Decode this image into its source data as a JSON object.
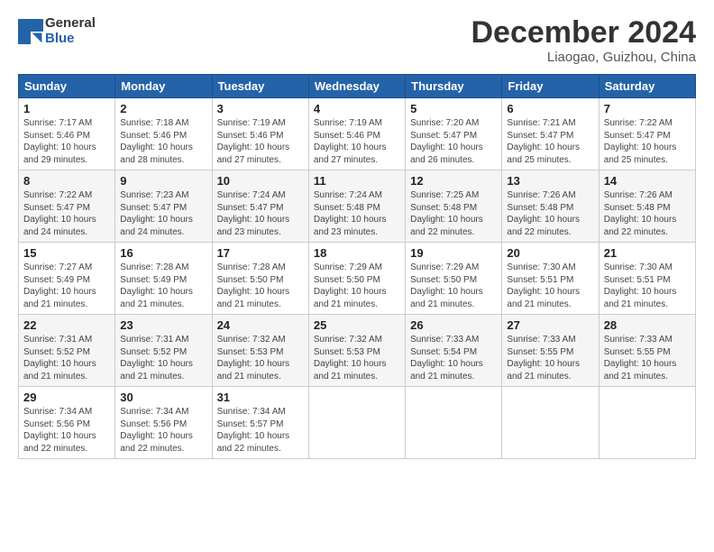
{
  "header": {
    "logo_line1": "General",
    "logo_line2": "Blue",
    "month": "December 2024",
    "location": "Liaogao, Guizhou, China"
  },
  "weekdays": [
    "Sunday",
    "Monday",
    "Tuesday",
    "Wednesday",
    "Thursday",
    "Friday",
    "Saturday"
  ],
  "weeks": [
    [
      {
        "day": "1",
        "info": "Sunrise: 7:17 AM\nSunset: 5:46 PM\nDaylight: 10 hours\nand 29 minutes."
      },
      {
        "day": "2",
        "info": "Sunrise: 7:18 AM\nSunset: 5:46 PM\nDaylight: 10 hours\nand 28 minutes."
      },
      {
        "day": "3",
        "info": "Sunrise: 7:19 AM\nSunset: 5:46 PM\nDaylight: 10 hours\nand 27 minutes."
      },
      {
        "day": "4",
        "info": "Sunrise: 7:19 AM\nSunset: 5:46 PM\nDaylight: 10 hours\nand 27 minutes."
      },
      {
        "day": "5",
        "info": "Sunrise: 7:20 AM\nSunset: 5:47 PM\nDaylight: 10 hours\nand 26 minutes."
      },
      {
        "day": "6",
        "info": "Sunrise: 7:21 AM\nSunset: 5:47 PM\nDaylight: 10 hours\nand 25 minutes."
      },
      {
        "day": "7",
        "info": "Sunrise: 7:22 AM\nSunset: 5:47 PM\nDaylight: 10 hours\nand 25 minutes."
      }
    ],
    [
      {
        "day": "8",
        "info": "Sunrise: 7:22 AM\nSunset: 5:47 PM\nDaylight: 10 hours\nand 24 minutes."
      },
      {
        "day": "9",
        "info": "Sunrise: 7:23 AM\nSunset: 5:47 PM\nDaylight: 10 hours\nand 24 minutes."
      },
      {
        "day": "10",
        "info": "Sunrise: 7:24 AM\nSunset: 5:47 PM\nDaylight: 10 hours\nand 23 minutes."
      },
      {
        "day": "11",
        "info": "Sunrise: 7:24 AM\nSunset: 5:48 PM\nDaylight: 10 hours\nand 23 minutes."
      },
      {
        "day": "12",
        "info": "Sunrise: 7:25 AM\nSunset: 5:48 PM\nDaylight: 10 hours\nand 22 minutes."
      },
      {
        "day": "13",
        "info": "Sunrise: 7:26 AM\nSunset: 5:48 PM\nDaylight: 10 hours\nand 22 minutes."
      },
      {
        "day": "14",
        "info": "Sunrise: 7:26 AM\nSunset: 5:48 PM\nDaylight: 10 hours\nand 22 minutes."
      }
    ],
    [
      {
        "day": "15",
        "info": "Sunrise: 7:27 AM\nSunset: 5:49 PM\nDaylight: 10 hours\nand 21 minutes."
      },
      {
        "day": "16",
        "info": "Sunrise: 7:28 AM\nSunset: 5:49 PM\nDaylight: 10 hours\nand 21 minutes."
      },
      {
        "day": "17",
        "info": "Sunrise: 7:28 AM\nSunset: 5:50 PM\nDaylight: 10 hours\nand 21 minutes."
      },
      {
        "day": "18",
        "info": "Sunrise: 7:29 AM\nSunset: 5:50 PM\nDaylight: 10 hours\nand 21 minutes."
      },
      {
        "day": "19",
        "info": "Sunrise: 7:29 AM\nSunset: 5:50 PM\nDaylight: 10 hours\nand 21 minutes."
      },
      {
        "day": "20",
        "info": "Sunrise: 7:30 AM\nSunset: 5:51 PM\nDaylight: 10 hours\nand 21 minutes."
      },
      {
        "day": "21",
        "info": "Sunrise: 7:30 AM\nSunset: 5:51 PM\nDaylight: 10 hours\nand 21 minutes."
      }
    ],
    [
      {
        "day": "22",
        "info": "Sunrise: 7:31 AM\nSunset: 5:52 PM\nDaylight: 10 hours\nand 21 minutes."
      },
      {
        "day": "23",
        "info": "Sunrise: 7:31 AM\nSunset: 5:52 PM\nDaylight: 10 hours\nand 21 minutes."
      },
      {
        "day": "24",
        "info": "Sunrise: 7:32 AM\nSunset: 5:53 PM\nDaylight: 10 hours\nand 21 minutes."
      },
      {
        "day": "25",
        "info": "Sunrise: 7:32 AM\nSunset: 5:53 PM\nDaylight: 10 hours\nand 21 minutes."
      },
      {
        "day": "26",
        "info": "Sunrise: 7:33 AM\nSunset: 5:54 PM\nDaylight: 10 hours\nand 21 minutes."
      },
      {
        "day": "27",
        "info": "Sunrise: 7:33 AM\nSunset: 5:55 PM\nDaylight: 10 hours\nand 21 minutes."
      },
      {
        "day": "28",
        "info": "Sunrise: 7:33 AM\nSunset: 5:55 PM\nDaylight: 10 hours\nand 21 minutes."
      }
    ],
    [
      {
        "day": "29",
        "info": "Sunrise: 7:34 AM\nSunset: 5:56 PM\nDaylight: 10 hours\nand 22 minutes."
      },
      {
        "day": "30",
        "info": "Sunrise: 7:34 AM\nSunset: 5:56 PM\nDaylight: 10 hours\nand 22 minutes."
      },
      {
        "day": "31",
        "info": "Sunrise: 7:34 AM\nSunset: 5:57 PM\nDaylight: 10 hours\nand 22 minutes."
      },
      {
        "day": "",
        "info": ""
      },
      {
        "day": "",
        "info": ""
      },
      {
        "day": "",
        "info": ""
      },
      {
        "day": "",
        "info": ""
      }
    ]
  ]
}
